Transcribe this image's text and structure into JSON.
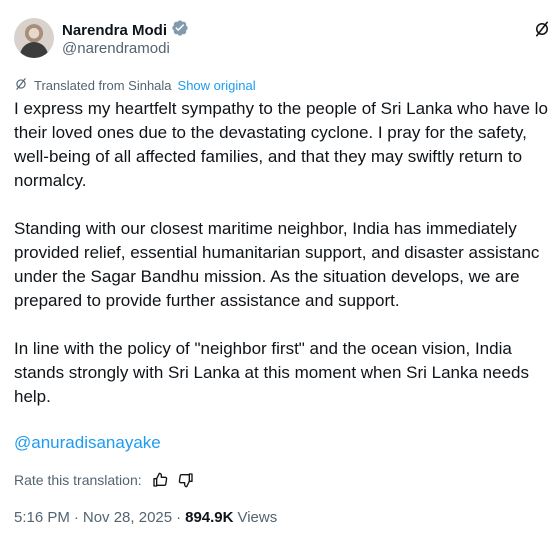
{
  "author": {
    "display_name": "Narendra Modi",
    "handle": "@narendramodi",
    "verified_badge_icon": "verified-gray-badge-icon"
  },
  "translation": {
    "label": "Translated from Sinhala",
    "show_original": "Show original"
  },
  "post": {
    "paragraph1": [
      "I express my heartfelt sympathy to the people of Sri Lanka who have lo",
      "their loved ones due to the devastating cyclone. I pray for the safety,",
      "well-being of all affected families, and that they may swiftly return to",
      "normalcy."
    ],
    "paragraph2": [
      "Standing with our closest maritime neighbor, India has immediately",
      "provided relief, essential humanitarian support, and disaster assistanc",
      "under the Sagar Bandhu mission. As the situation develops, we are",
      "prepared to provide further assistance and support."
    ],
    "paragraph3": [
      "In line with the policy of \"neighbor first\" and the ocean vision, India",
      "stands strongly with Sri Lanka at this moment when Sri Lanka needs",
      "help."
    ],
    "mention": "@anuradisanayake"
  },
  "rating": {
    "label": "Rate this translation:"
  },
  "meta": {
    "time": "5:16 PM",
    "separator": "·",
    "date": "Nov 28, 2025",
    "views_count": "894.9K",
    "views_label": "Views"
  },
  "colors": {
    "text": "#0f1419",
    "secondary": "#536471",
    "link": "#1d9bf0",
    "verified_badge": "#829aab"
  }
}
